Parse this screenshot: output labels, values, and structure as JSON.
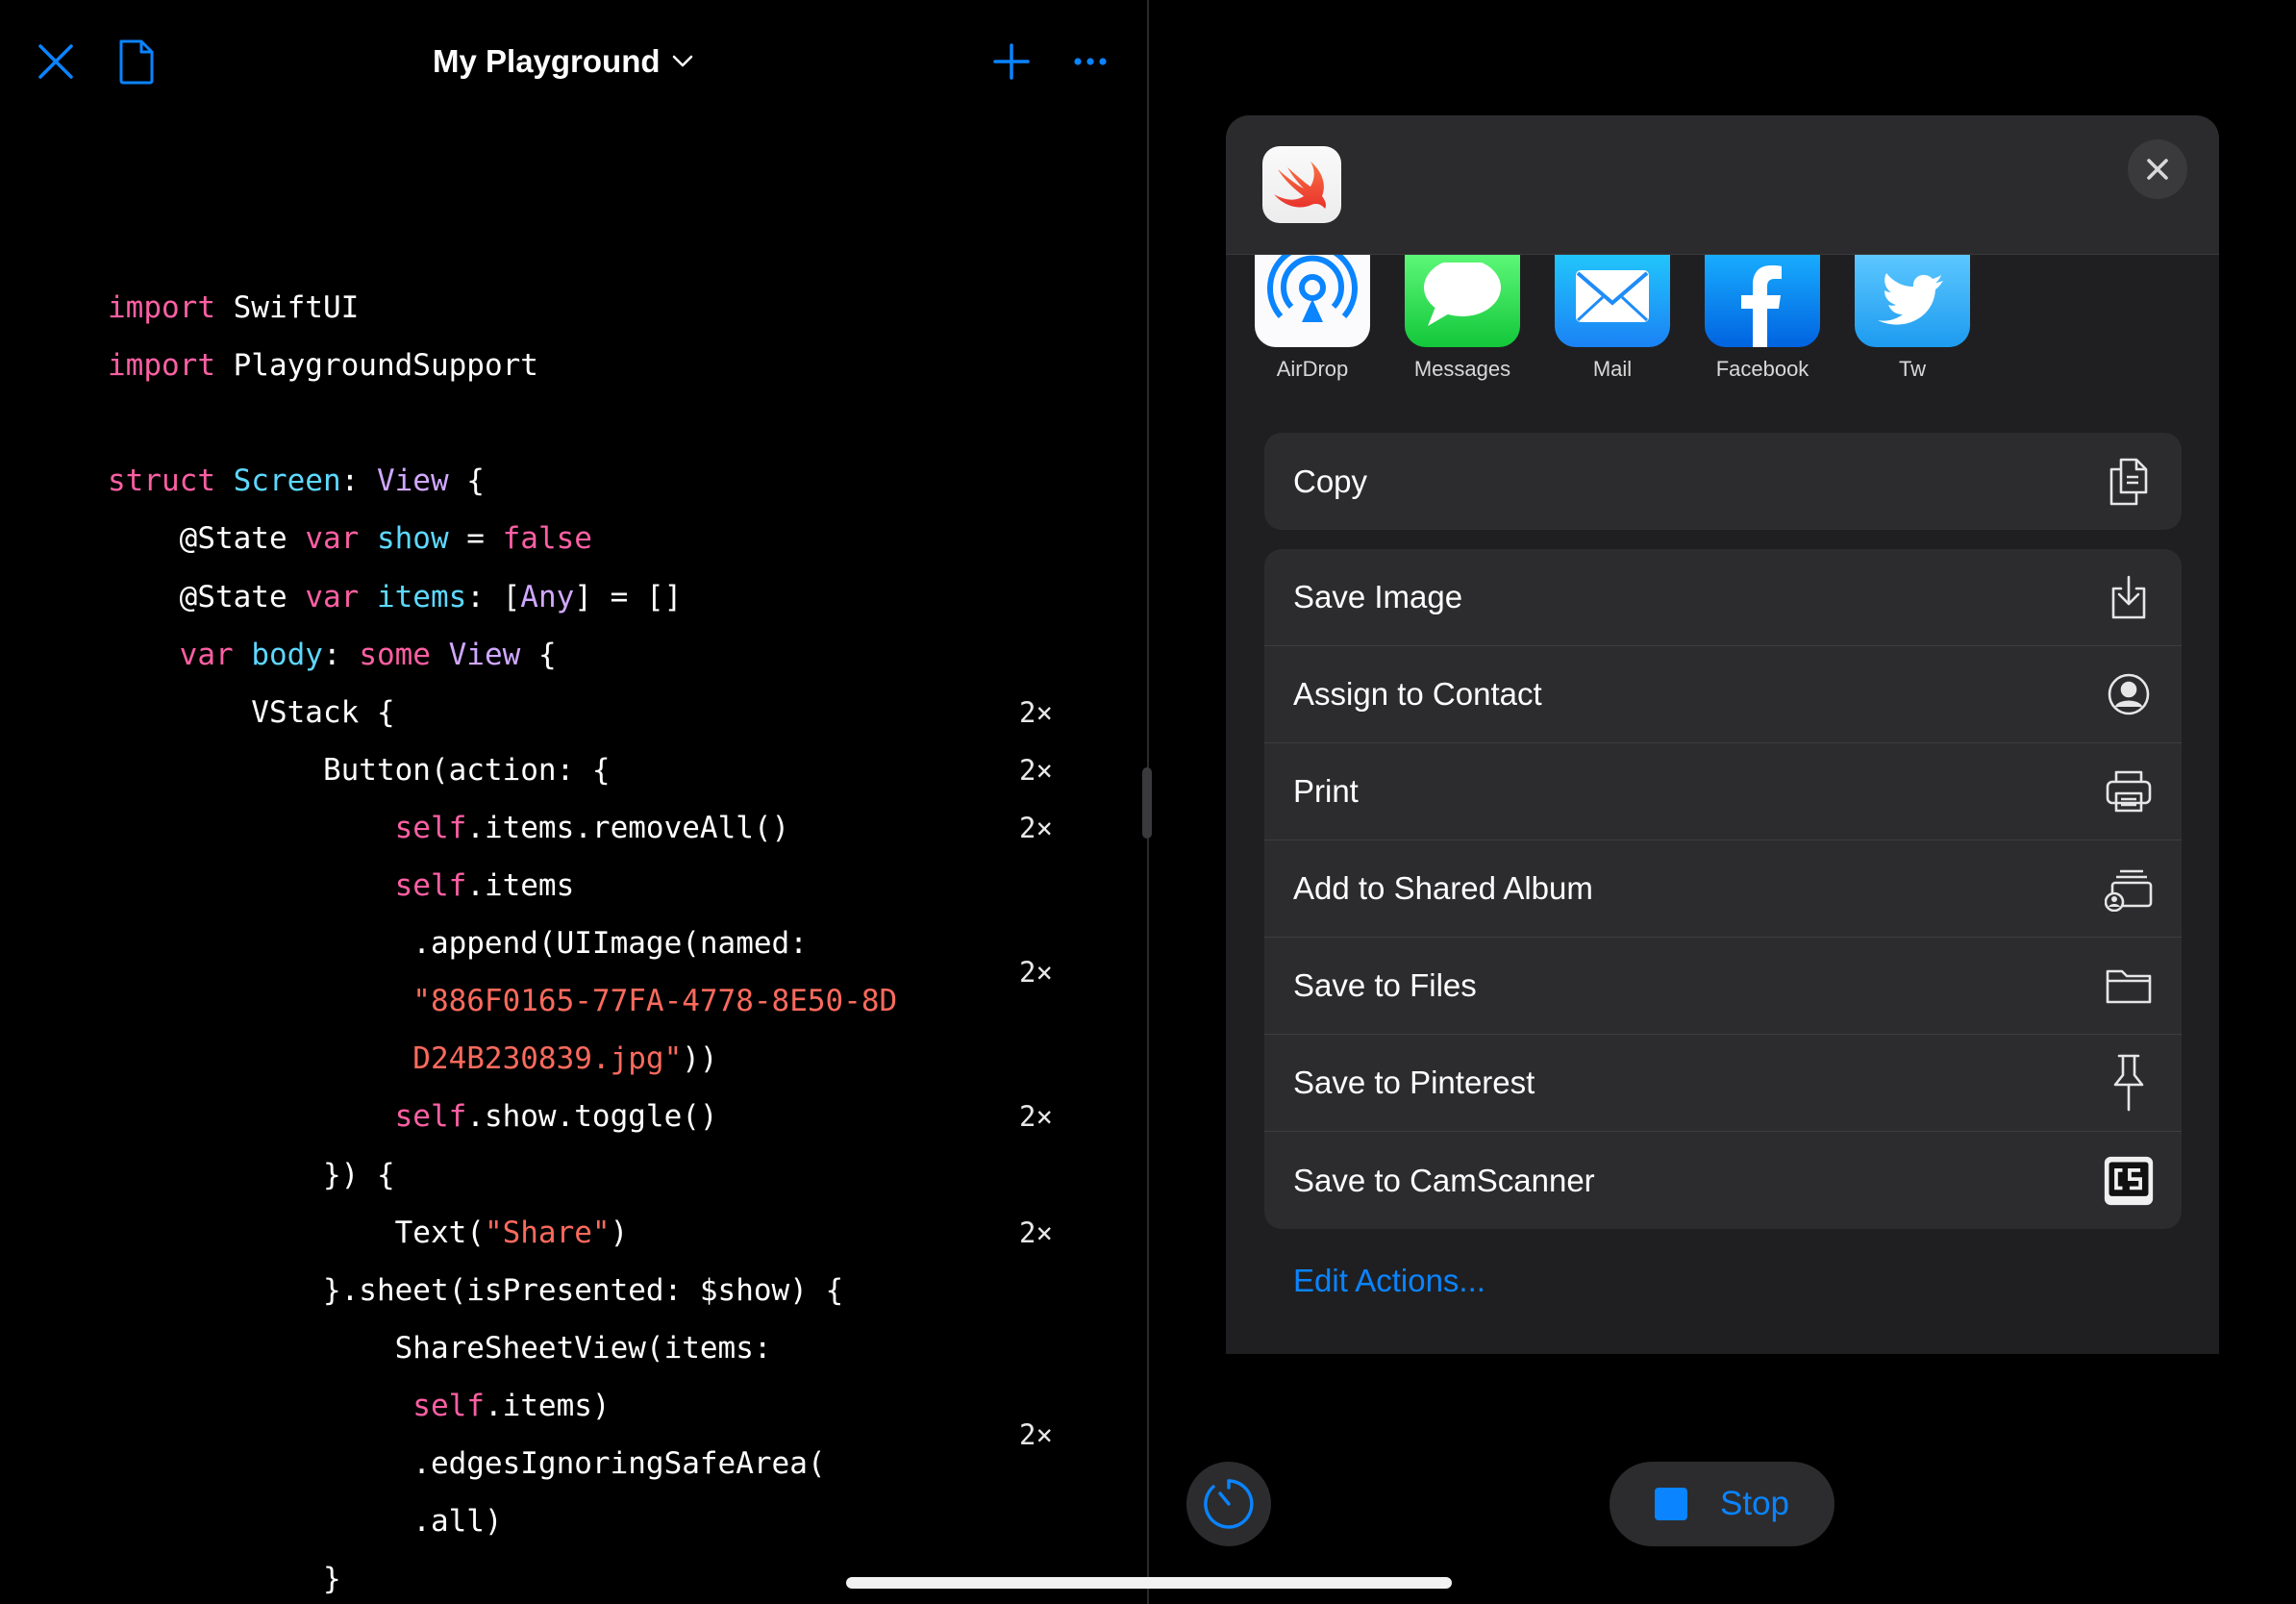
{
  "toolbar": {
    "title": "My Playground"
  },
  "code": {
    "lines": [
      [
        {
          "t": "k",
          "v": "import"
        },
        {
          "t": "n",
          "v": " SwiftUI"
        }
      ],
      [
        {
          "t": "k",
          "v": "import"
        },
        {
          "t": "n",
          "v": " PlaygroundSupport"
        }
      ],
      [],
      [
        {
          "t": "k",
          "v": "struct"
        },
        {
          "t": "p",
          "v": " Screen"
        },
        {
          "t": "n",
          "v": ": "
        },
        {
          "t": "t",
          "v": "View"
        },
        {
          "t": "n",
          "v": " {"
        }
      ],
      [
        {
          "t": "n",
          "v": "    @State "
        },
        {
          "t": "k",
          "v": "var"
        },
        {
          "t": "p",
          "v": " show"
        },
        {
          "t": "n",
          "v": " = "
        },
        {
          "t": "k",
          "v": "false"
        }
      ],
      [
        {
          "t": "n",
          "v": "    @State "
        },
        {
          "t": "k",
          "v": "var"
        },
        {
          "t": "p",
          "v": " items"
        },
        {
          "t": "n",
          "v": ": ["
        },
        {
          "t": "t",
          "v": "Any"
        },
        {
          "t": "n",
          "v": "] = []"
        }
      ],
      [
        {
          "t": "n",
          "v": "    "
        },
        {
          "t": "k",
          "v": "var"
        },
        {
          "t": "p",
          "v": " body"
        },
        {
          "t": "n",
          "v": ": "
        },
        {
          "t": "k",
          "v": "some"
        },
        {
          "t": "t",
          "v": " View"
        },
        {
          "t": "n",
          "v": " {"
        }
      ],
      [
        {
          "t": "n",
          "v": "        VStack {"
        }
      ],
      [
        {
          "t": "n",
          "v": "            Button(action: {"
        }
      ],
      [
        {
          "t": "k",
          "v": "                self"
        },
        {
          "t": "n",
          "v": ".items.removeAll()"
        }
      ],
      [
        {
          "t": "k",
          "v": "                self"
        },
        {
          "t": "n",
          "v": ".items"
        }
      ],
      [
        {
          "t": "n",
          "v": "                 .append(UIImage(named:"
        }
      ],
      [
        {
          "t": "s",
          "v": "                 \"886F0165-77FA-4778-8E50-8D"
        }
      ],
      [
        {
          "t": "s",
          "v": "                 D24B230839.jpg\""
        },
        {
          "t": "n",
          "v": "))"
        }
      ],
      [
        {
          "t": "k",
          "v": "                self"
        },
        {
          "t": "n",
          "v": ".show.toggle()"
        }
      ],
      [
        {
          "t": "n",
          "v": "            }) {"
        }
      ],
      [
        {
          "t": "n",
          "v": "                Text("
        },
        {
          "t": "s",
          "v": "\"Share\""
        },
        {
          "t": "n",
          "v": ")"
        }
      ],
      [
        {
          "t": "n",
          "v": "            }.sheet(isPresented: $show) {"
        }
      ],
      [
        {
          "t": "n",
          "v": "                ShareSheetView(items:"
        }
      ],
      [
        {
          "t": "k",
          "v": "                 self"
        },
        {
          "t": "n",
          "v": ".items)"
        }
      ],
      [
        {
          "t": "n",
          "v": "                 .edgesIgnoringSafeArea("
        }
      ],
      [
        {
          "t": "n",
          "v": "                 .all)"
        }
      ],
      [
        {
          "t": "n",
          "v": "            }"
        }
      ]
    ],
    "results": [
      {
        "line": 7,
        "label": "2×"
      },
      {
        "line": 8,
        "label": "2×"
      },
      {
        "line": 9,
        "label": "2×"
      },
      {
        "line": 11.5,
        "label": "2×"
      },
      {
        "line": 14,
        "label": "2×"
      },
      {
        "line": 16,
        "label": "2×"
      },
      {
        "line": 19.5,
        "label": "2×"
      }
    ]
  },
  "share_targets": [
    {
      "label": "AirDrop",
      "icon": "airdrop-icon"
    },
    {
      "label": "Messages",
      "icon": "messages-icon"
    },
    {
      "label": "Mail",
      "icon": "mail-icon"
    },
    {
      "label": "Facebook",
      "icon": "facebook-icon"
    },
    {
      "label": "Tw",
      "icon": "twitter-icon"
    }
  ],
  "actions": {
    "copy": {
      "label": "Copy",
      "icon": "copy-icon"
    },
    "list": [
      {
        "label": "Save Image",
        "icon": "save-image-icon"
      },
      {
        "label": "Assign to Contact",
        "icon": "contact-icon"
      },
      {
        "label": "Print",
        "icon": "printer-icon"
      },
      {
        "label": "Add to Shared Album",
        "icon": "shared-album-icon"
      },
      {
        "label": "Save to Files",
        "icon": "folder-icon"
      },
      {
        "label": "Save to Pinterest",
        "icon": "pin-icon"
      },
      {
        "label": "Save to CamScanner",
        "icon": "camscanner-icon"
      }
    ],
    "edit_label": "Edit Actions..."
  },
  "controls": {
    "stop_label": "Stop"
  },
  "colors": {
    "accent": "#0a84ff",
    "keyword": "#fc5fa3",
    "type": "#d0a8ff",
    "property": "#5dd8ff",
    "string": "#fc6a5d"
  }
}
